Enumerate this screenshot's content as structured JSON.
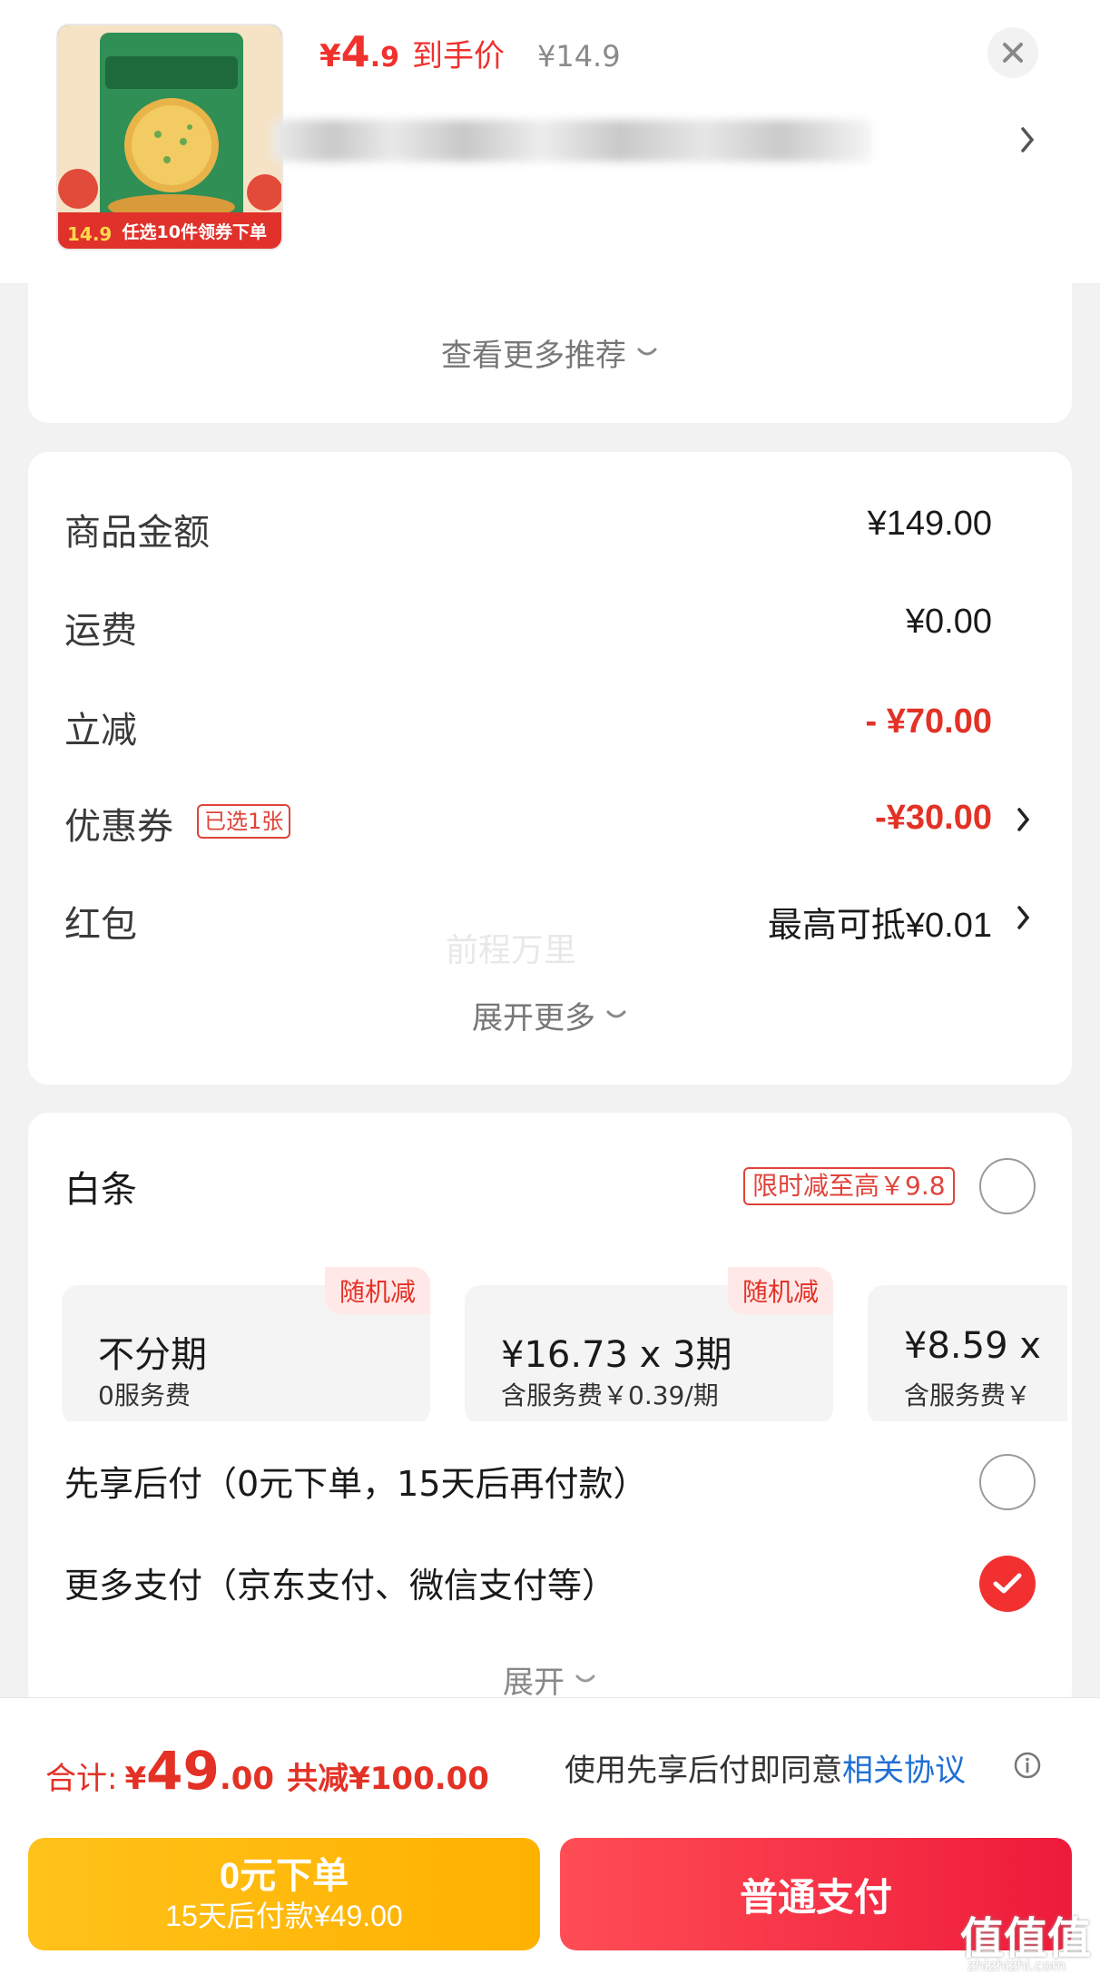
{
  "product": {
    "thumb_banner": "任选10件领券下单",
    "thumb_price": "14.9",
    "price_symbol": "¥",
    "price_int": "4",
    "price_dec": ".9",
    "hand_price_label": "到手价",
    "original_price": "¥14.9"
  },
  "more_recommend": "查看更多推荐",
  "summary": {
    "rows": [
      {
        "label": "商品金额",
        "value": "¥149.00"
      },
      {
        "label": "运费",
        "value": "¥0.00"
      },
      {
        "label": "立减",
        "value": "- ¥70.00"
      },
      {
        "label": "优惠券",
        "value": "-¥30.00",
        "badge": "已选1张"
      },
      {
        "label": "红包",
        "value": "最高可抵¥0.01"
      }
    ],
    "watermark": "前程万里",
    "expand_more": "展开更多"
  },
  "payment": {
    "baitiao_label": "白条",
    "baitiao_promo": "限时减至高￥9.8",
    "plans": [
      {
        "title": "不分期",
        "sub": "0服务费",
        "tag": "随机减"
      },
      {
        "title": "¥16.73 x 3期",
        "sub": "含服务费￥0.39/期",
        "tag": "随机减"
      },
      {
        "title": "¥8.59 x",
        "sub": "含服务费￥"
      }
    ],
    "bnpl_option": "先享后付（0元下单，15天后再付款）",
    "more_option": "更多支付（京东支付、微信支付等）",
    "expand": "展开"
  },
  "bottom": {
    "total_label": "合计:",
    "total_symbol": "¥",
    "total_int": "49",
    "total_dec": ".00",
    "total_saved": "共减¥100.00",
    "agree_text": "使用先享后付即同意",
    "agree_link": "相关协议",
    "bnpl_title": "0元下单",
    "bnpl_sub": "15天后付款¥49.00",
    "normal_pay": "普通支付",
    "site_watermark": "值值值",
    "site_watermark_sub": "zhizhizhi.com"
  },
  "colors": {
    "accent_red": "#e33126",
    "button_yellow": "#ffb100",
    "button_red": "#ee1a3a",
    "link_blue": "#1f6fd6"
  }
}
